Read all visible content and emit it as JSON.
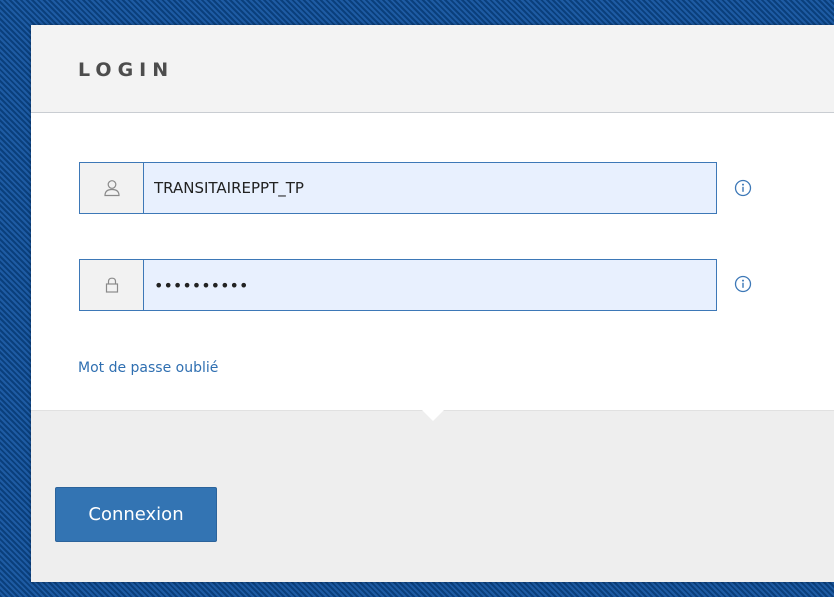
{
  "login_panel": {
    "title": "LOGIN",
    "username": {
      "value": "TRANSITAIREPPT_TP",
      "icon": "user-icon",
      "info_icon": "info-icon"
    },
    "password": {
      "value": "••••••••••",
      "icon": "lock-icon",
      "info_icon": "info-icon"
    },
    "forgot_password_label": "Mot de passe oublié",
    "submit_label": "Connexion"
  },
  "colors": {
    "accent": "#3374b3",
    "input_border": "#3d78b7",
    "input_fill": "#e8f0fe",
    "background": "#0a3f7c"
  }
}
